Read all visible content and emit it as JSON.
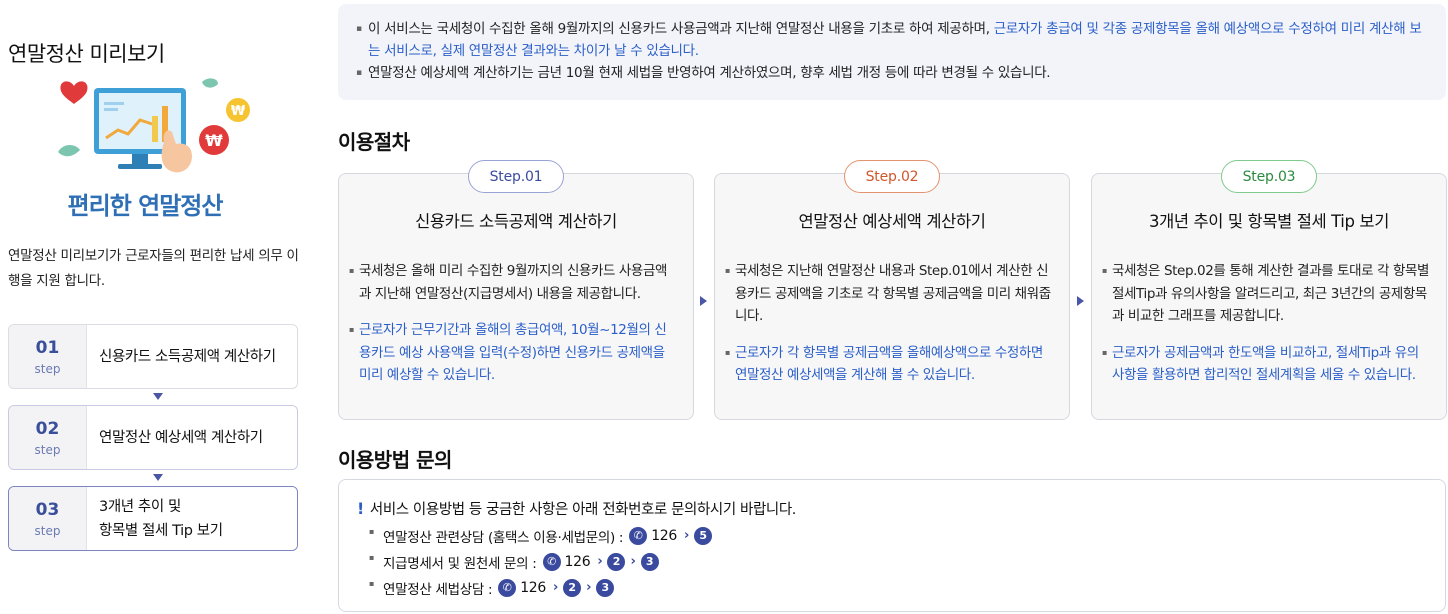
{
  "sidebar": {
    "title": "연말정산 미리보기",
    "illustration_caption": "편리한 연말정산",
    "description": "연말정산 미리보기가 근로자들의  편리한 납세 의무 이행을 지원 합니다.",
    "steps": [
      {
        "num": "01",
        "sub": "step",
        "label": "신용카드 소득공제액 계산하기"
      },
      {
        "num": "02",
        "sub": "step",
        "label": "연말정산 예상세액 계산하기"
      },
      {
        "num": "03",
        "sub": "step",
        "label_line1": "3개년 추이 및",
        "label_line2": "항목별 절세 Tip 보기"
      }
    ]
  },
  "notice": {
    "line1_normal": "이 서비스는 국세청이 수집한 올해 9월까지의 신용카드 사용금액과 지난해 연말정산 내용을 기초로 하여 제공하며, ",
    "line1_highlight": "근로자가 총급여 및 각종 공제항목을 올해 예상액으로 수정하여 미리 계산해 보는 서비스로, 실제 연말정산 결과와는 차이가 날 수 있습니다.",
    "line2": "연말정산 예상세액 계산하기는 금년 10월 현재 세법을 반영하여 계산하였으며, 향후 세법 개정 등에 따라 변경될 수 있습니다."
  },
  "procedure": {
    "title": "이용절차",
    "cards": [
      {
        "step": "Step.01",
        "title": "신용카드 소득공제액 계산하기",
        "bullet_dark": "국세청은 올해 미리 수집한 9월까지의 신용카드 사용금액과 지난해 연말정산(지급명세서) 내용을 제공합니다.",
        "bullet_blue": "근로자가 근무기간과 올해의 총급여액, 10월~12월의 신용카드 예상 사용액을 입력(수정)하면 신용카드 공제액을 미리 예상할 수 있습니다."
      },
      {
        "step": "Step.02",
        "title": "연말정산 예상세액 계산하기",
        "bullet_dark": "국세청은 지난해 연말정산 내용과 Step.01에서 계산한 신용카드 공제액을 기초로 각 항목별 공제금액을 미리 채워줍니다.",
        "bullet_blue": "근로자가 각 항목별 공제금액을 올해예상액으로 수정하면 연말정산 예상세액을 계산해 볼 수 있습니다."
      },
      {
        "step": "Step.03",
        "title": "3개년 추이 및 항목별 절세 Tip 보기",
        "bullet_dark": "국세청은 Step.02를 통해 계산한 결과를 토대로 각 항목별 절세Tip과 유의사항을 알려드리고, 최근 3년간의 공제항목과 비교한 그래프를 제공합니다.",
        "bullet_blue": "근로자가 공제금액과 한도액을 비교하고, 절세Tip과 유의사항을 활용하면 합리적인 절세계획을 세울 수 있습니다."
      }
    ]
  },
  "inquiry": {
    "title": "이용방법 문의",
    "lead": "서비스 이용방법 등 궁금한 사항은 아래 전화번호로 문의하시기 바랍니다.",
    "items": [
      {
        "label": "연말정산 관련상담 (홈택스 이용·세법문의) :",
        "number": "126",
        "menu": [
          "5"
        ]
      },
      {
        "label": "지급명세서 및 원천세 문의 :",
        "number": "126",
        "menu": [
          "2",
          "3"
        ]
      },
      {
        "label": "연말정산 세법상담 :",
        "number": "126",
        "menu": [
          "2",
          "3"
        ]
      }
    ]
  },
  "colors": {
    "accent_blue": "#2b5fc7",
    "navy": "#3a4a9e",
    "step2_orange": "#d0562b",
    "step3_green": "#2c8a3e"
  }
}
